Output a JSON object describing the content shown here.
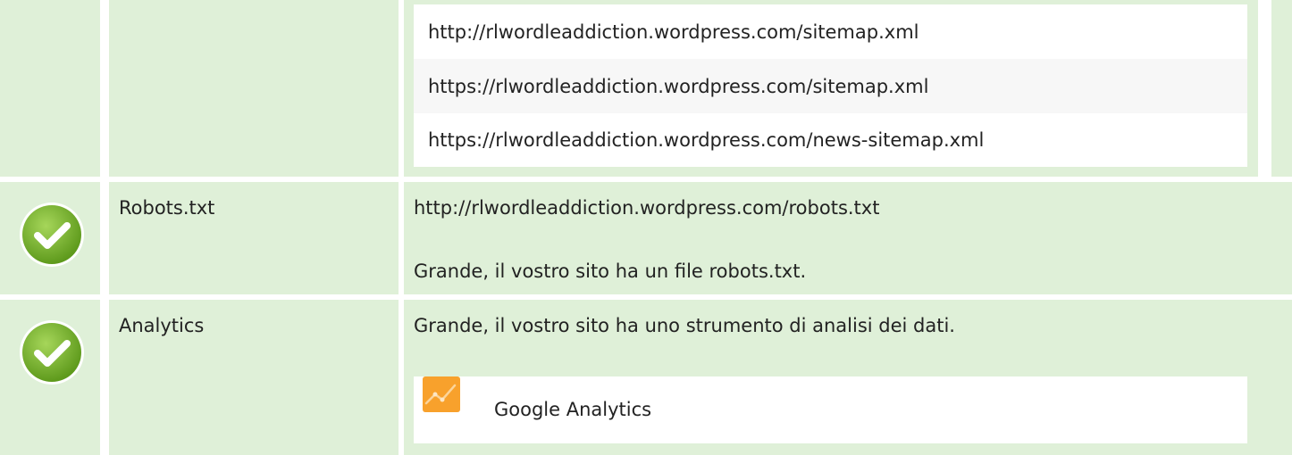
{
  "sitemaps": {
    "urls": [
      "http://rlwordleaddiction.wordpress.com/sitemap.xml",
      "https://rlwordleaddiction.wordpress.com/sitemap.xml",
      "https://rlwordleaddiction.wordpress.com/news-sitemap.xml"
    ]
  },
  "robots": {
    "label": "Robots.txt",
    "url": "http://rlwordleaddiction.wordpress.com/robots.txt",
    "message": "Grande, il vostro sito ha un file robots.txt.",
    "status_icon": "check-circle-icon"
  },
  "analytics": {
    "label": "Analytics",
    "message": "Grande, il vostro sito ha uno strumento di analisi dei dati.",
    "tool": "Google Analytics",
    "tool_icon": "google-analytics-icon",
    "status_icon": "check-circle-icon"
  },
  "colors": {
    "row_bg": "#dff0d8",
    "check_green": "#7ab730",
    "ga_orange": "#f8a12c"
  }
}
